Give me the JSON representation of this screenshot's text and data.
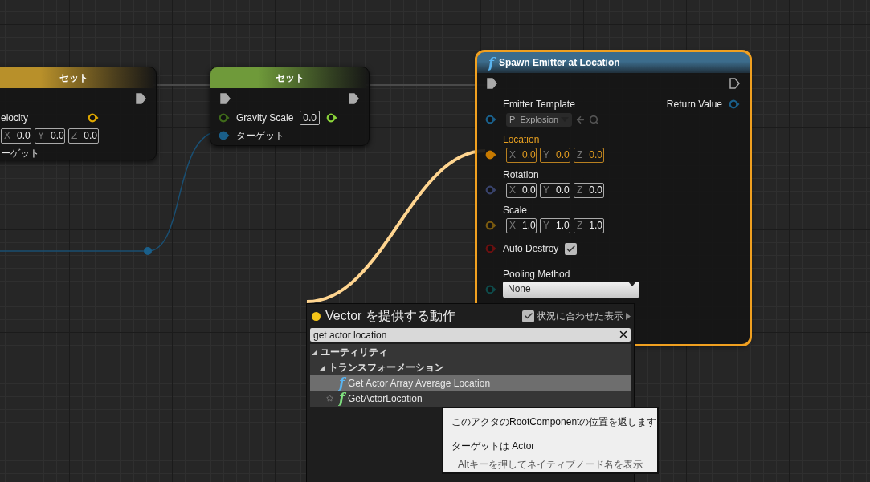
{
  "nodes": [
    {
      "kind": "set",
      "title": "セット",
      "color": "#b8902a",
      "selected": false,
      "exec_out": {
        "connected": true
      },
      "pins": [
        {
          "kind": "vector",
          "label": "elocity",
          "out_pin": {
            "color": "#e0a800"
          },
          "fields": [
            {
              "axis": "X",
              "value": "0.0"
            },
            {
              "axis": "Y",
              "value": "0.0"
            },
            {
              "axis": "Z",
              "value": "0.0"
            }
          ]
        },
        {
          "kind": "object",
          "label": "ーゲット"
        }
      ]
    },
    {
      "kind": "set",
      "title": "セット",
      "color": "#6f9a3a",
      "selected": false,
      "exec_in": {
        "connected": true
      },
      "exec_out": {
        "connected": true
      },
      "pins": [
        {
          "kind": "float",
          "label": "Gravity Scale",
          "in_pin": {
            "color": "#3f6a1a",
            "connected": false
          },
          "out_pin": {
            "color": "#8bd43a"
          },
          "value": "0.0"
        },
        {
          "kind": "object",
          "label": "ターゲット",
          "in_pin": {
            "color": "#1a5f8a",
            "connected": true
          }
        }
      ]
    },
    {
      "kind": "function",
      "icon": "f",
      "title": "Spawn Emitter at Location",
      "color": "#3c6c8c",
      "selected": true,
      "exec_in": {
        "connected": true
      },
      "exec_out": {
        "connected": false
      },
      "outputs": [
        {
          "label": "Return Value",
          "color": "#1a5f8a"
        }
      ],
      "pins": [
        {
          "kind": "asset",
          "label": "Emitter Template",
          "in_pin": {
            "color": "#1a5f8a",
            "connected": false
          },
          "value": "P_Explosion"
        },
        {
          "kind": "vector",
          "label": "Location",
          "in_pin": {
            "color": "#c77a00",
            "connected": true
          },
          "highlighted": true,
          "fields": [
            {
              "axis": "X",
              "value": "0.0"
            },
            {
              "axis": "Y",
              "value": "0.0"
            },
            {
              "axis": "Z",
              "value": "0.0"
            }
          ]
        },
        {
          "kind": "vector",
          "label": "Rotation",
          "in_pin": {
            "color": "#38426a",
            "connected": false
          },
          "fields": [
            {
              "axis": "X",
              "value": "0.0"
            },
            {
              "axis": "Y",
              "value": "0.0"
            },
            {
              "axis": "Z",
              "value": "0.0"
            }
          ]
        },
        {
          "kind": "vector",
          "label": "Scale",
          "in_pin": {
            "color": "#7a5a10",
            "connected": false
          },
          "fields": [
            {
              "axis": "X",
              "value": "1.0"
            },
            {
              "axis": "Y",
              "value": "1.0"
            },
            {
              "axis": "Z",
              "value": "1.0"
            }
          ]
        },
        {
          "kind": "bool",
          "label": "Auto Destroy",
          "in_pin": {
            "color": "#6a1010",
            "connected": false
          },
          "checked": true
        },
        {
          "kind": "enum",
          "label": "Pooling Method",
          "in_pin": {
            "color": "#0f4a4a",
            "connected": false
          },
          "value": "None"
        }
      ]
    }
  ],
  "action_menu": {
    "title": "Vector を提供する動作",
    "context_sensitive": {
      "label": "状況に合わせた表示",
      "checked": true
    },
    "search": {
      "value": "get actor location"
    },
    "tree": [
      {
        "label": "ユーティリティ",
        "expanded": true,
        "children": [
          {
            "label": "トランスフォーメーション",
            "expanded": true,
            "children": [
              {
                "icon": "f",
                "label": "Get Actor Array Average Location",
                "color": "#5ab4f0",
                "selected": true,
                "star": false
              },
              {
                "icon": "f",
                "label": "GetActorLocation",
                "color": "#7fe07f",
                "selected": false,
                "star": true
              }
            ]
          }
        ]
      }
    ]
  },
  "tooltip": {
    "description": "このアクタのRootComponentの位置を返します",
    "target": "ターゲットは Actor",
    "hint": "Altキーを押してネイティブノード名を表示"
  }
}
